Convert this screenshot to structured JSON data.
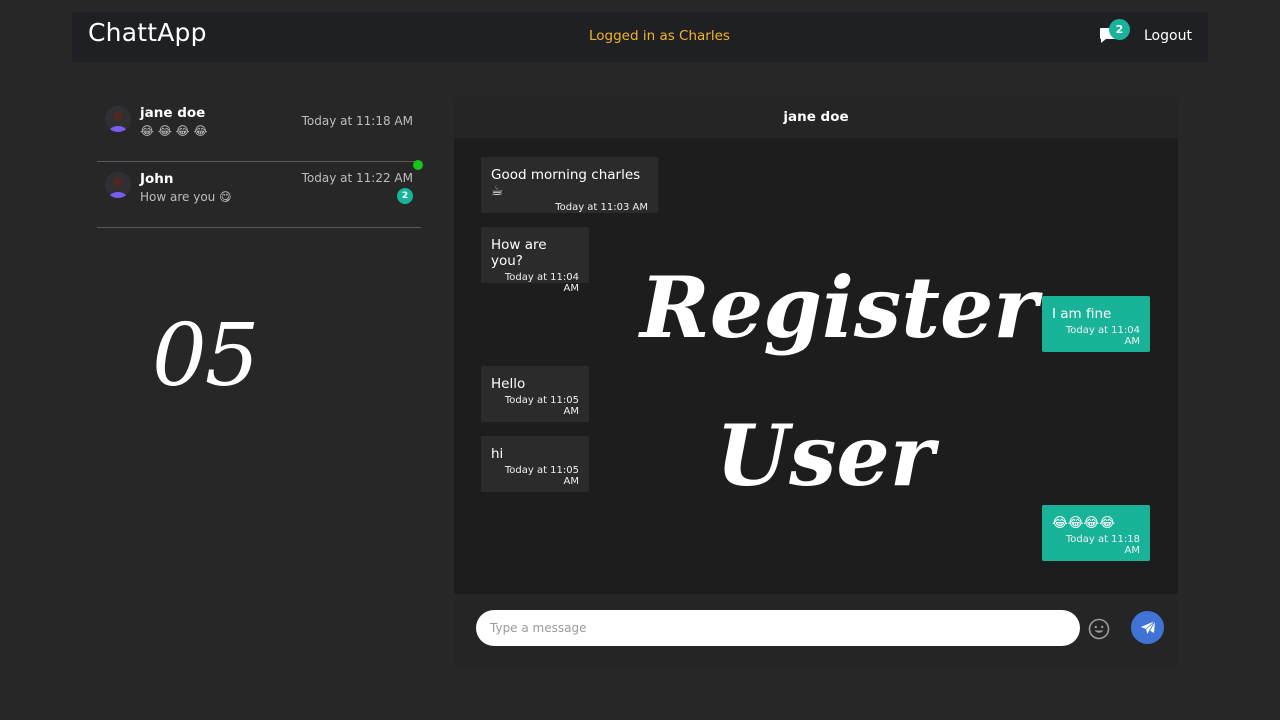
{
  "navbar": {
    "brand": "ChattApp",
    "logged_in_text": "Logged in as Charles",
    "notification_count": "2",
    "logout_label": "Logout"
  },
  "sidebar": {
    "conversations": [
      {
        "name": "jane doe",
        "preview": "😂 😂 😂 😂",
        "time": "Today at 11:18 AM"
      },
      {
        "name": "John",
        "preview": "How are you 😋",
        "time": "Today at 11:22 AM",
        "unread": "2",
        "online": true
      }
    ]
  },
  "overlay": {
    "number": "05",
    "title_line1": "Register",
    "title_line2": "User"
  },
  "chat": {
    "header_name": "jane doe",
    "messages": [
      {
        "direction": "in",
        "text": "Good morning charles ☕",
        "time": "Today at 11:03 AM"
      },
      {
        "direction": "in",
        "text": "How are you?",
        "time": "Today at 11:04 AM"
      },
      {
        "direction": "out",
        "text": "I am fine",
        "time": "Today at 11:04 AM"
      },
      {
        "direction": "in",
        "text": "Hello",
        "time": "Today at 11:05 AM"
      },
      {
        "direction": "in",
        "text": "hi",
        "time": "Today at 11:05 AM"
      },
      {
        "direction": "out",
        "text": "😂😂😂😂",
        "time": "Today at 11:18 AM"
      }
    ],
    "input_placeholder": "Type a message"
  },
  "colors": {
    "accent_teal": "#19b39a",
    "logged_in_yellow": "#f1b52b",
    "send_blue": "#3f74d6",
    "online_green": "#18c41a"
  }
}
